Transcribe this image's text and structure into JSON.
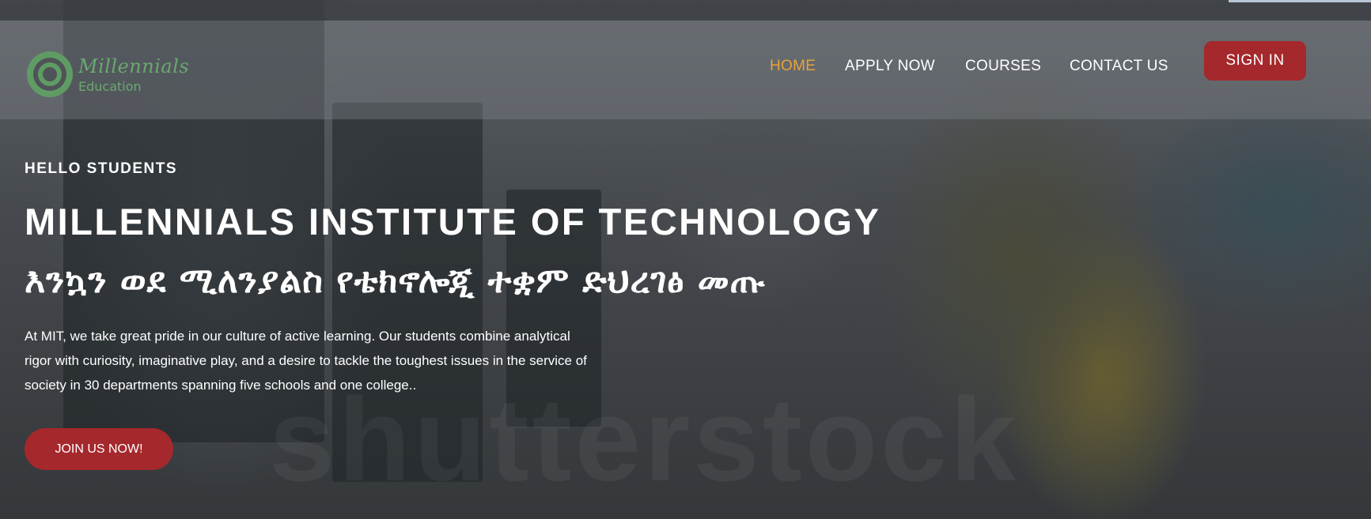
{
  "brand": {
    "name": "Millennials",
    "tagline": "Education",
    "color": "#6aa86f"
  },
  "nav": {
    "items": [
      {
        "label": "HOME",
        "active": true
      },
      {
        "label": "APPLY NOW",
        "active": false
      },
      {
        "label": "COURSES",
        "active": false
      },
      {
        "label": "CONTACT US",
        "active": false
      }
    ],
    "signin_label": "SIGN IN"
  },
  "hero": {
    "kicker": "HELLO STUDENTS",
    "title": "MILLENNIALS INSTITUTE OF TECHNOLOGY",
    "subtitle_amharic": "እንኳን ወደ ሚለንያልስ የቴክኖሎጂ ተቋም ድህረገፅ መጡ",
    "description": "At MIT, we take great pride in our culture of active learning. Our students combine analytical rigor with curiosity, imaginative play, and a desire to tackle the toughest issues in the service of society in 30 departments spanning five schools and one college..",
    "cta_label": "JOIN US NOW!"
  },
  "watermark": "shutterstock",
  "colors": {
    "accent_red": "#a5282c",
    "active_nav": "#e8a33c"
  }
}
